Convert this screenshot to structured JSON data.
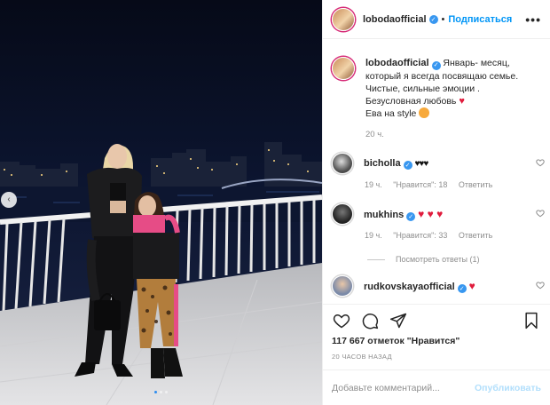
{
  "post": {
    "username": "lobodaofficial",
    "verified_mark": "✓",
    "follow_label": "Подписаться",
    "dot": "•",
    "more_label": "•••",
    "caption": {
      "lines": [
        "Январь- месяц,",
        "который я всегда посвящаю семье.",
        "Чистые, сильные эмоции .",
        "Безусловная любовь",
        "Ева на style"
      ],
      "heart": "♥",
      "time": "20 ч."
    },
    "comments": [
      {
        "username": "bicholla",
        "text": "♥♥♥",
        "time": "19 ч.",
        "likes": "\"Нравится\": 18",
        "reply": "Ответить"
      },
      {
        "username": "mukhins",
        "text": "♥ ♥ ♥",
        "time": "19 ч.",
        "likes": "\"Нравится\": 33",
        "reply": "Ответить"
      },
      {
        "username": "rudkovskayaofficial",
        "text": "♥"
      }
    ],
    "view_replies": "Посмотреть ответы (1)",
    "likes_count": "117 667 отметок \"Нравится\"",
    "posted_ago": "20 ЧАСОВ НАЗАД",
    "comment_placeholder": "Добавьте комментарий...",
    "publish_label": "Опубликовать",
    "nav_prev": "‹"
  },
  "icons": [
    "heart-icon",
    "comment-icon",
    "share-icon",
    "bookmark-icon",
    "chevron-left-icon"
  ],
  "colors": {
    "link_blue": "#0095f6",
    "heart_red": "#e01b3c",
    "muted": "#8e8e8e",
    "border": "#efefef"
  }
}
